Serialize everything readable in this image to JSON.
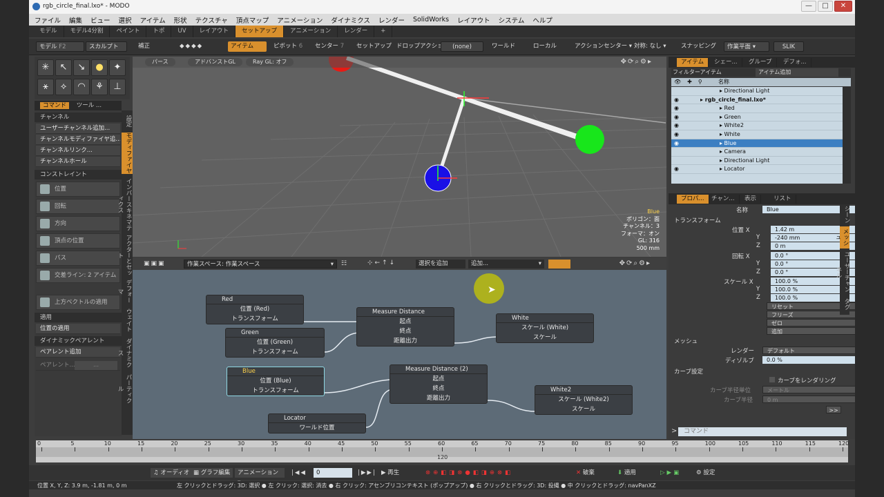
{
  "window": {
    "title": "rgb_circle_final.lxo* - MODO",
    "min": "—",
    "max": "□",
    "close": "✕"
  },
  "menu": [
    "ファイル",
    "編集",
    "ビュー",
    "選択",
    "アイテム",
    "形状",
    "テクスチャ",
    "頂点マップ",
    "アニメーション",
    "ダイナミクス",
    "レンダー",
    "SolidWorks",
    "レイアウト",
    "システム",
    "ヘルプ"
  ],
  "layout_tabs": [
    "モデル",
    "モデル4分割",
    "ペイント",
    "トポ",
    "UV",
    "レイアウト",
    "セットアップ",
    "アニメーション",
    "レンダー",
    "+"
  ],
  "active_tab": "セットアップ",
  "toolbar": {
    "model": "モデル",
    "model_key": "F2",
    "sculpt": "スカルプト",
    "correct": "補正",
    "item": "アイテム",
    "pivot": "ピボット",
    "pivot_key": "6",
    "center": "センター",
    "center_key": "7",
    "setup": "セットアップ",
    "drop_action": "ドロップアクション",
    "none": "(none)",
    "world": "ワールド",
    "local": "ローカル",
    "action_center": "アクションセンター ▾",
    "symmetry": "対称: なし ▾",
    "snapping": "スナッピング",
    "work_plane": "作業平面 ▾",
    "slik": "SLIK"
  },
  "left_panel": {
    "tab_command": "コマンド",
    "tab_tool": "ツール ...",
    "section_channel": "チャンネル",
    "items_channel": [
      "ユーザーチャンネル追加...",
      "チャンネルモディファイヤ追...",
      "チャンネルリンク...",
      "チャンネルホール"
    ],
    "section_constraint": "コンストレイント",
    "constraints": [
      "位置",
      "回転",
      "方向",
      "頂点の位置",
      "パス",
      "交差ライン: 2 アイテム"
    ],
    "up_vector": "上方ベクトルの適用",
    "section_apply": "適用",
    "apply_position": "位置の適用",
    "section_dynamic": "ダイナミックペアレント",
    "add_parent": "ペアレント追加",
    "parent_label": "ペアレント...",
    "parent_value": "...",
    "vertical_tabs": [
      "設定",
      "モディファイヤ",
      "インバースキネマティクス",
      "アクターとセット",
      "デフォーマ",
      "ウェイト",
      "ダイナミクス",
      "パーティクル"
    ]
  },
  "viewport": {
    "btn_persp": "パース",
    "btn_advgl": "アドバンストGL",
    "btn_raygl": "Ray GL: オフ",
    "info": [
      "Blue",
      "ポリゴン：面",
      "チャンネル：3",
      "フォーマ：オン",
      "GL: 316",
      "500 mm"
    ]
  },
  "schematic": {
    "workspace_label": "作業スペース:",
    "workspace_value": "作業スペース",
    "add_selection": "選択を追加",
    "add": "追加...",
    "nodes": {
      "red": {
        "title": "Red",
        "pos": "位置 (Red)",
        "transform": "トランスフォーム"
      },
      "green": {
        "title": "Green",
        "pos": "位置 (Green)",
        "transform": "トランスフォーム"
      },
      "blue": {
        "title": "Blue",
        "pos": "位置 (Blue)",
        "transform": "トランスフォーム"
      },
      "locator": {
        "title": "Locator",
        "world": "ワールド位置"
      },
      "md1": {
        "title": "Measure Distance",
        "start": "起点",
        "end": "終点",
        "out": "距離出力"
      },
      "md2": {
        "title": "Measure Distance (2)",
        "start": "起点",
        "end": "終点",
        "out": "距離出力"
      },
      "white": {
        "title": "White",
        "scale": "スケール (White)",
        "scale2": "スケール"
      },
      "white2": {
        "title": "White2",
        "scale": "スケール (White2)",
        "scale2": "スケール"
      }
    }
  },
  "right_panel": {
    "tabs_top": [
      "アイテム",
      "シェー...",
      "グループ",
      "デフォ..."
    ],
    "filter": "フィルターアイテム",
    "add_item": "アイテム追加",
    "col_name": "名称",
    "tree": [
      {
        "label": "Directional Light",
        "indent": 5,
        "sel": false,
        "eye": false
      },
      {
        "label": "rgb_circle_final.lxo*",
        "indent": 3,
        "sel": false,
        "eye": true,
        "bold": true
      },
      {
        "label": "Red",
        "indent": 5,
        "sel": false,
        "eye": true
      },
      {
        "label": "Green",
        "indent": 5,
        "sel": false,
        "eye": true
      },
      {
        "label": "White2",
        "indent": 5,
        "sel": false,
        "eye": true
      },
      {
        "label": "White",
        "indent": 5,
        "sel": false,
        "eye": true
      },
      {
        "label": "Blue",
        "indent": 5,
        "sel": true,
        "eye": true
      },
      {
        "label": "Camera",
        "indent": 5,
        "sel": false,
        "eye": false
      },
      {
        "label": "Directional Light",
        "indent": 5,
        "sel": false,
        "eye": false
      },
      {
        "label": "Locator",
        "indent": 5,
        "sel": false,
        "eye": true
      }
    ],
    "tabs_bottom": [
      "プロパ...",
      "チャン...",
      "表示",
      "リスト"
    ],
    "name_label": "名称",
    "name_value": "Blue",
    "section_transform": "トランスフォーム",
    "position_label": "位置 X",
    "pos": [
      "1.42 m",
      "-240 mm",
      "0 m"
    ],
    "rotation_label": "回転 X",
    "rot": [
      "0.0 °",
      "0.0 °",
      "0.0 °"
    ],
    "scale_label": "スケール X",
    "scale": [
      "100.0 %",
      "100.0 %",
      "100.0 %"
    ],
    "axis_y": "Y",
    "axis_z": "Z",
    "dropdowns": [
      "リセット",
      "フリーズ",
      "ゼロ",
      "追加"
    ],
    "section_mesh": "メッシュ",
    "render_label": "レンダー",
    "render_value": "デフォルト",
    "dissolve_label": "ディゾルブ",
    "dissolve_value": "0.0 %",
    "section_curve": "カーブ設定",
    "render_curves": "カーブをレンダリング",
    "curve_radius_unit": "カーブ半径単位",
    "curve_radius_unit_value": "メートル",
    "curve_radius": "カーブ半径",
    "curve_radius_value": "0 m",
    "more": ">>",
    "side_tabs": [
      "シーン",
      "メッシュ",
      "ユーザーチャンネル",
      "タグ"
    ],
    "command_placeholder": "コマンド"
  },
  "timeline": {
    "ticks": [
      0,
      5,
      10,
      15,
      20,
      25,
      30,
      35,
      40,
      45,
      50,
      55,
      60,
      65,
      70,
      75,
      80,
      85,
      90,
      95,
      100,
      105,
      110,
      115,
      120
    ],
    "end": "120"
  },
  "playbar": {
    "audio": "オーディオ",
    "graph": "グラフ編集",
    "anim": "アニメーション ▾",
    "frame": "0",
    "play": "再生",
    "discard": "破棄",
    "apply": "適用",
    "settings": "設定"
  },
  "status": {
    "pos": "位置 X, Y, Z: 3.9 m, -1.81 m, 0 m",
    "hint": "左 クリックとドラッグ: 3D: 選択 ● 左 クリック: 選択: 消去 ● 右 クリック: アセンブリコンテキスト (ポップアップ) ● 右 クリックとドラッグ: 3D: 投縄 ● 中 クリックとドラッグ: navPanXZ"
  }
}
